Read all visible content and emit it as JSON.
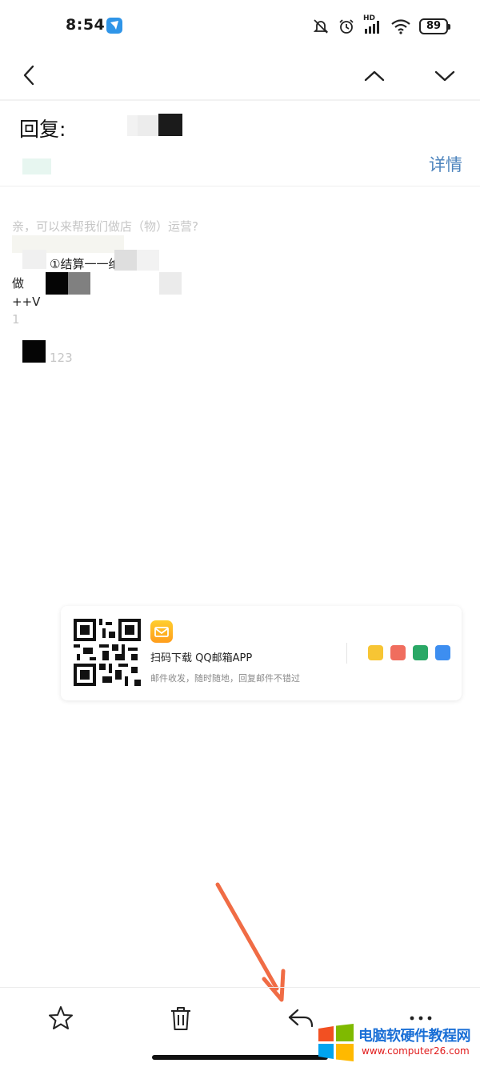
{
  "status_bar": {
    "time": "8:54",
    "battery": "89",
    "network_label": "HD"
  },
  "nav": {
    "back_icon": "chevron-left-icon",
    "prev_icon": "chevron-up-icon",
    "next_icon": "chevron-down-icon"
  },
  "email": {
    "subject_prefix": "回复:",
    "details_label": "详情",
    "body_lines": [
      "亲，可以来帮我们做店（物）运营?",
      "①结算一一绝不",
      "做",
      "++V",
      "1",
      "123"
    ]
  },
  "promo_card": {
    "title": "扫码下载 QQ邮箱APP",
    "subtitle": "邮件收发，随时随地，回复邮件不错过",
    "mini_icons": [
      "mail-icon",
      "calendar-icon",
      "note-icon",
      "appstore-icon"
    ],
    "mini_icon_colors": [
      "#f7c534",
      "#f06d5e",
      "#2aa866",
      "#3d8ef0"
    ]
  },
  "toolbar": {
    "star_icon": "star-icon",
    "delete_icon": "trash-icon",
    "reply_icon": "reply-icon",
    "more_icon": "more-icon"
  },
  "watermark": {
    "title": "电脑软硬件教程网",
    "url": "www.computer26.com"
  },
  "colors": {
    "accent": "#4d84bd",
    "annotation_arrow": "#f06c45"
  }
}
